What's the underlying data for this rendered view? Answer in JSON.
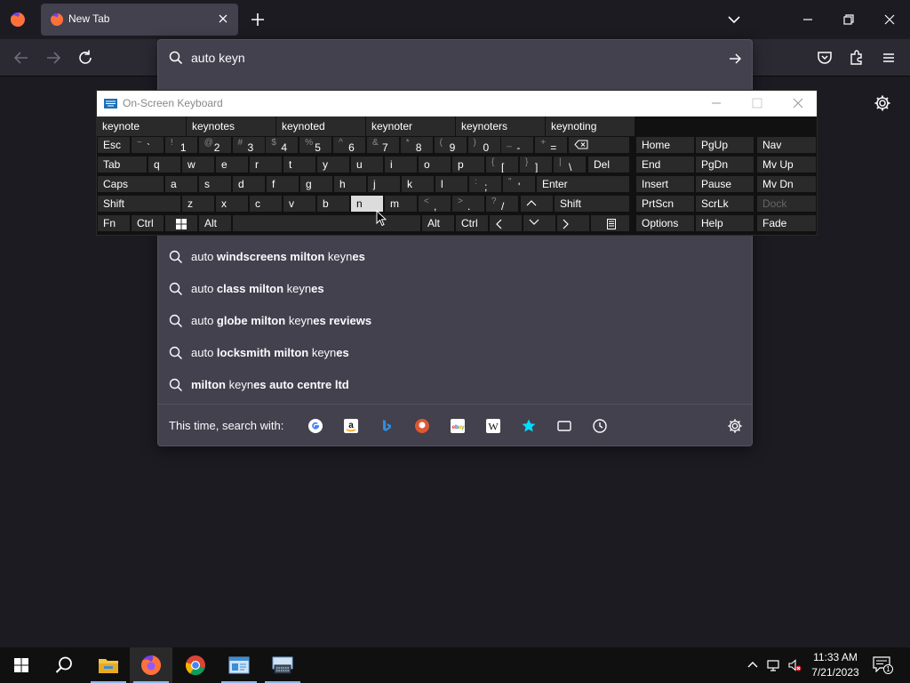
{
  "tab": {
    "title": "New Tab"
  },
  "urlbar": {
    "value": "auto keyn",
    "suggestions": [
      {
        "pre": "auto ",
        "bold": "windscreens milton",
        "mid": " keyn",
        "post": "es"
      },
      {
        "pre": "auto ",
        "bold": "class milton",
        "mid": " keyn",
        "post": "es"
      },
      {
        "pre": "auto ",
        "bold": "globe milton",
        "mid": " keyn",
        "post": "es reviews"
      },
      {
        "pre": "auto ",
        "bold": "locksmith milton",
        "mid": " keyn",
        "post": "es"
      },
      {
        "pre": "",
        "bold": "milton",
        "mid": " keyn",
        "post": "es auto centre ltd"
      }
    ],
    "search_with_label": "This time, search with:"
  },
  "osk": {
    "title": "On-Screen Keyboard",
    "predictions": [
      "keynote",
      "keynotes",
      "keynoted",
      "keynoter",
      "keynoters",
      "keynoting"
    ],
    "rows": {
      "r1": [
        {
          "sub": "~",
          "main": "`"
        },
        {
          "sub": "!",
          "main": "1"
        },
        {
          "sub": "@",
          "main": "2"
        },
        {
          "sub": "#",
          "main": "3"
        },
        {
          "sub": "$",
          "main": "4"
        },
        {
          "sub": "%",
          "main": "5"
        },
        {
          "sub": "^",
          "main": "6"
        },
        {
          "sub": "&",
          "main": "7"
        },
        {
          "sub": "*",
          "main": "8"
        },
        {
          "sub": "(",
          "main": "9"
        },
        {
          "sub": ")",
          "main": "0"
        },
        {
          "sub": "_",
          "main": "-"
        },
        {
          "sub": "+",
          "main": "="
        }
      ],
      "r2": [
        "q",
        "w",
        "e",
        "r",
        "t",
        "y",
        "u",
        "i",
        "o",
        "p"
      ],
      "r2_brackets": [
        {
          "sub": "{",
          "main": "["
        },
        {
          "sub": "}",
          "main": "]"
        },
        {
          "sub": "|",
          "main": "\\"
        }
      ],
      "r3": [
        "a",
        "s",
        "d",
        "f",
        "g",
        "h",
        "j",
        "k",
        "l"
      ],
      "r3_punct": [
        {
          "sub": ":",
          "main": ";"
        },
        {
          "sub": "\"",
          "main": "'"
        }
      ],
      "r4": [
        "z",
        "x",
        "c",
        "v",
        "b",
        "n",
        "m"
      ],
      "r4_punct": [
        {
          "sub": "<",
          "main": ","
        },
        {
          "sub": ">",
          "main": "."
        },
        {
          "sub": "?",
          "main": "/"
        }
      ]
    },
    "labels": {
      "esc": "Esc",
      "tab": "Tab",
      "del": "Del",
      "caps": "Caps",
      "enter": "Enter",
      "shift": "Shift",
      "fn": "Fn",
      "ctrl": "Ctrl",
      "alt": "Alt",
      "home": "Home",
      "pgup": "PgUp",
      "nav": "Nav",
      "end": "End",
      "pgdn": "PgDn",
      "mvup": "Mv Up",
      "insert": "Insert",
      "pause": "Pause",
      "mvdn": "Mv Dn",
      "prtscn": "PrtScn",
      "scrlk": "ScrLk",
      "dock": "Dock",
      "options": "Options",
      "help": "Help",
      "fade": "Fade"
    }
  },
  "taskbar": {
    "time": "11:33 AM",
    "date": "7/21/2023",
    "notification_count": "1"
  },
  "colors": {
    "accent": "#8bb6e8",
    "panel": "#42414d",
    "key": "#2a2a2a"
  }
}
